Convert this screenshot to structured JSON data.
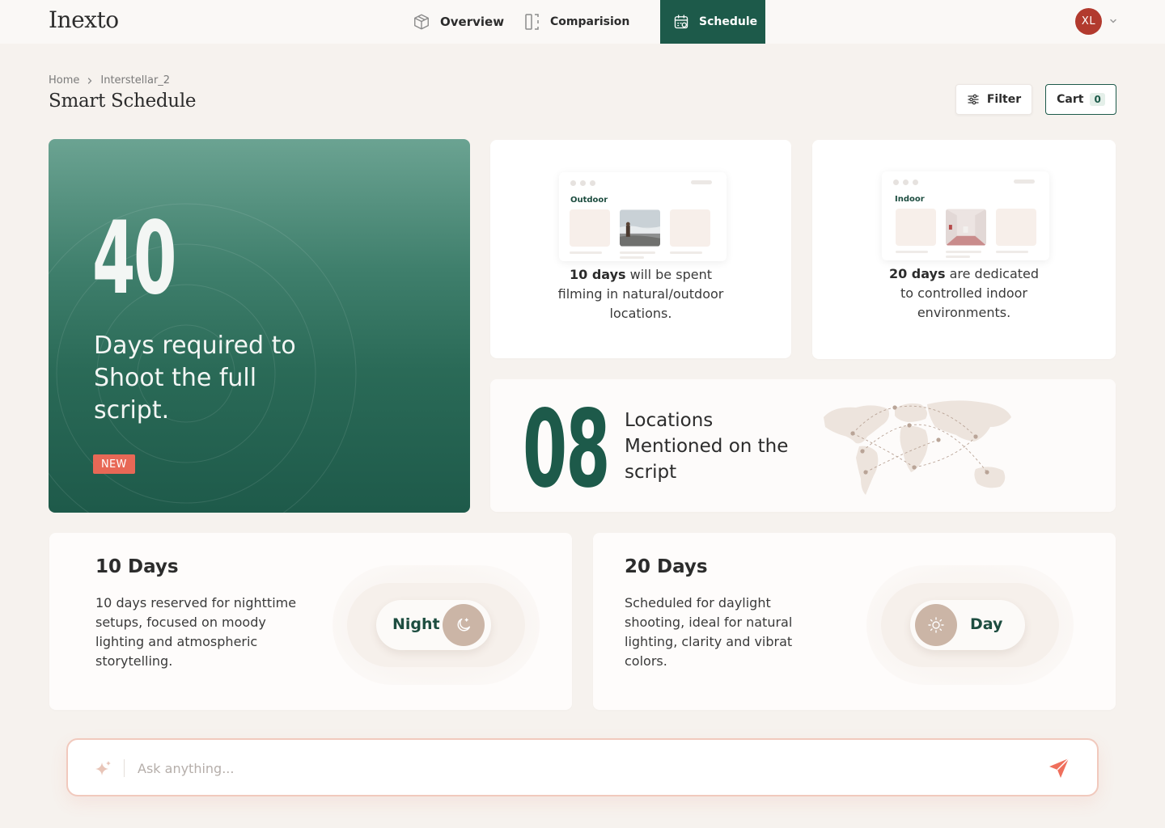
{
  "app": {
    "logo": "Inexto"
  },
  "nav": {
    "items": [
      {
        "label": "Overview",
        "icon": "cube-icon"
      },
      {
        "label": "Comparision",
        "icon": "split-panel-icon"
      },
      {
        "label": "Schedule",
        "icon": "calendar-icon",
        "active": true
      }
    ]
  },
  "user": {
    "initials": "XL"
  },
  "breadcrumb": {
    "home": "Home",
    "current": "Interstellar_2"
  },
  "page": {
    "title": "Smart Schedule"
  },
  "toolbar": {
    "filter_label": "Filter",
    "cart_label": "Cart",
    "cart_count": "0"
  },
  "hero": {
    "number": "40",
    "text": "Days required to Shoot the full script.",
    "badge": "NEW"
  },
  "outdoor_card": {
    "mock_label": "Outdoor",
    "highlight": "10 days",
    "caption_line1": " will be spent",
    "caption_line2": "filming in natural/outdoor",
    "caption_line3": "locations."
  },
  "indoor_card": {
    "mock_label": "Indoor",
    "highlight": "20 days",
    "caption_line1": " are dedicated",
    "caption_line2": "to controlled indoor",
    "caption_line3": "environments."
  },
  "locations_card": {
    "number": "08",
    "text": "Locations Mentioned on the script"
  },
  "night_card": {
    "title": "10 Days",
    "description": "10 days reserved for nighttime setups, focused on moody lighting and atmospheric storytelling.",
    "toggle_label": "Night",
    "toggle_icon": "moon-icon"
  },
  "day_card": {
    "title": "20 Days",
    "description": "Scheduled for daylight shooting, ideal for natural lighting, clarity and vibrat colors.",
    "toggle_label": "Day",
    "toggle_icon": "sun-icon"
  },
  "ask": {
    "placeholder": "Ask anything..."
  },
  "colors": {
    "brand_green": "#1d5a4a",
    "accent_coral": "#e86856",
    "avatar_red": "#b23a2e",
    "knob_tan": "#cbb5a6"
  }
}
